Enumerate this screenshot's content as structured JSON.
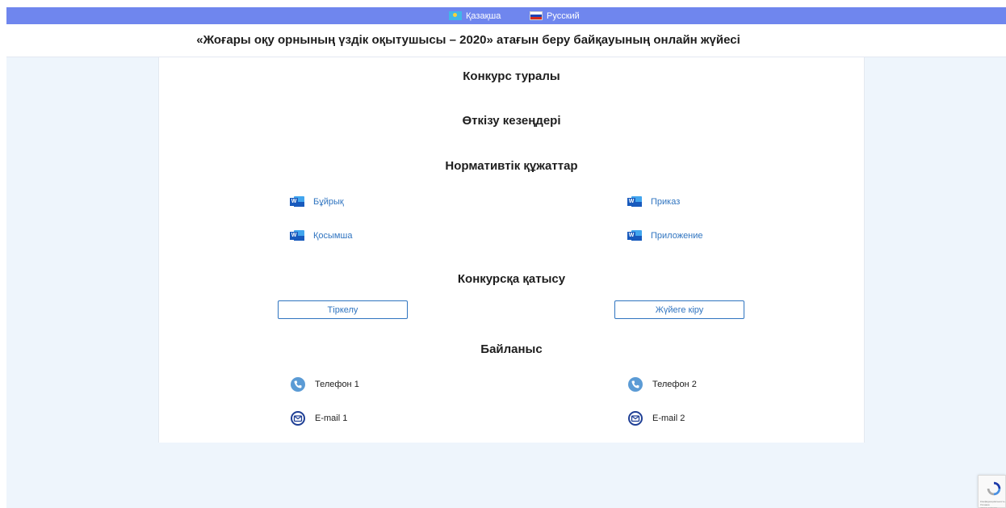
{
  "languages": {
    "kazakh": "Қазақша",
    "russian": "Русский"
  },
  "header": {
    "title": "«Жоғары оқу орнының үздік оқытушысы – 2020» атағын беру байқауының онлайн жүйесі"
  },
  "sections": {
    "about": "Конкурс туралы",
    "stages": "Өткізу кезеңдері",
    "documents": "Нормативтік құжаттар",
    "participation": "Конкурсқа қатысу",
    "contacts": "Байланыс"
  },
  "documents": {
    "order_kz": "Бұйрық",
    "order_ru": "Приказ",
    "appendix_kz": "Қосымша",
    "appendix_ru": "Приложение",
    "icon_letter": "W"
  },
  "buttons": {
    "register": "Тіркелу",
    "login": "Жүйеге кіру"
  },
  "contacts": {
    "phone1": "Телефон 1",
    "phone2": "Телефон 2",
    "email1": "E-mail 1",
    "email2": "E-mail 2"
  },
  "recaptcha": {
    "label": "Конфиденциальность - Условия использования"
  },
  "colors": {
    "lang_bar": "#6f86ee",
    "link": "#2f74c0",
    "background": "#eef5fc",
    "contact_icon": "#5b9bd5"
  },
  "icons": {
    "word": "word-document-icon",
    "phone": "phone-icon",
    "email": "envelope-icon",
    "recaptcha": "recaptcha-icon"
  }
}
